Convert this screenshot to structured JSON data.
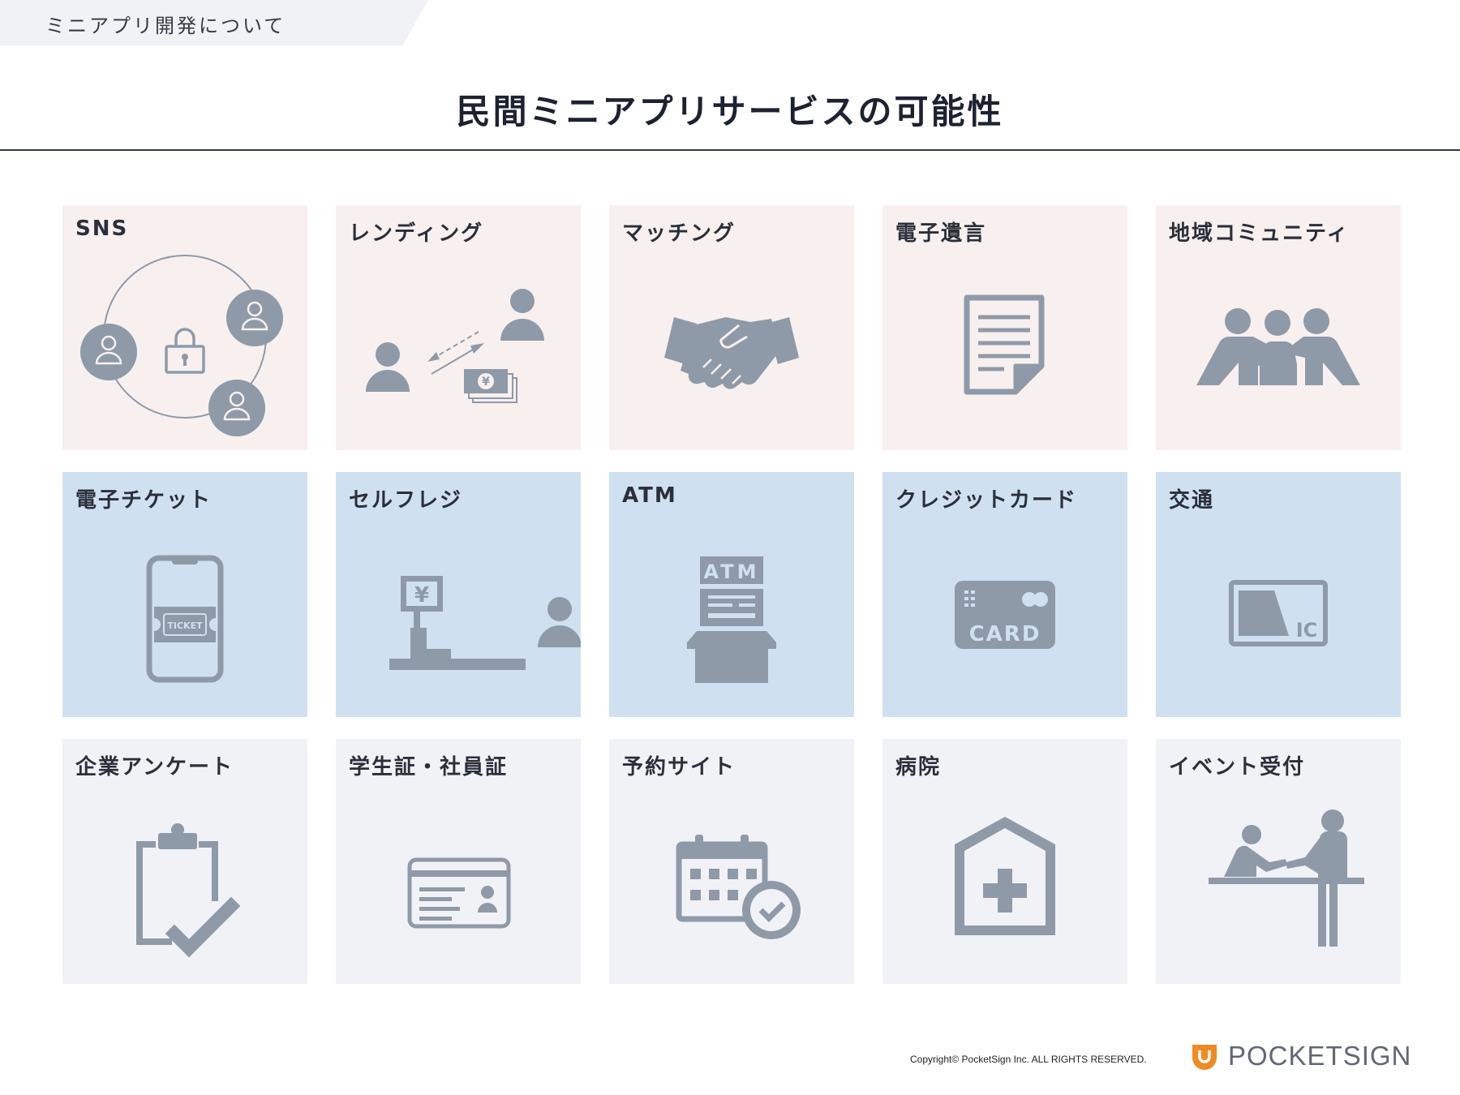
{
  "header": {
    "section_tab": "ミニアプリ開発について",
    "title": "民間ミニアプリサービスの可能性"
  },
  "colors": {
    "row1_bg": "#f7f0ee",
    "row2_bg": "#cfe0f1",
    "row3_bg": "#f1f2f6",
    "icon": "#8f9aa8",
    "brand_orange": "#f08a24"
  },
  "cards": [
    {
      "label": "SNS",
      "icon": "network-lock-icon"
    },
    {
      "label": "レンディング",
      "icon": "lending-icon"
    },
    {
      "label": "マッチング",
      "icon": "handshake-icon"
    },
    {
      "label": "電子遺言",
      "icon": "document-icon"
    },
    {
      "label": "地域コミュニティ",
      "icon": "community-icon"
    },
    {
      "label": "電子チケット",
      "icon": "phone-ticket-icon",
      "icon_text": "TICKET"
    },
    {
      "label": "セルフレジ",
      "icon": "self-checkout-icon",
      "icon_text": "¥"
    },
    {
      "label": "ATM",
      "icon": "atm-icon",
      "icon_text": "ATM"
    },
    {
      "label": "クレジットカード",
      "icon": "credit-card-icon",
      "icon_text": "CARD"
    },
    {
      "label": "交通",
      "icon": "ic-card-icon",
      "icon_text": "IC"
    },
    {
      "label": "企業アンケート",
      "icon": "clipboard-check-icon"
    },
    {
      "label": "学生証・社員証",
      "icon": "id-card-icon"
    },
    {
      "label": "予約サイト",
      "icon": "calendar-check-icon"
    },
    {
      "label": "病院",
      "icon": "hospital-icon"
    },
    {
      "label": "イベント受付",
      "icon": "reception-icon"
    }
  ],
  "lending": {
    "bill_symbol": "¥"
  },
  "footer": {
    "copyright": "Copyright© PocketSign Inc. ALL RIGHTS RESERVED.",
    "brand": "POCKETSIGN"
  }
}
